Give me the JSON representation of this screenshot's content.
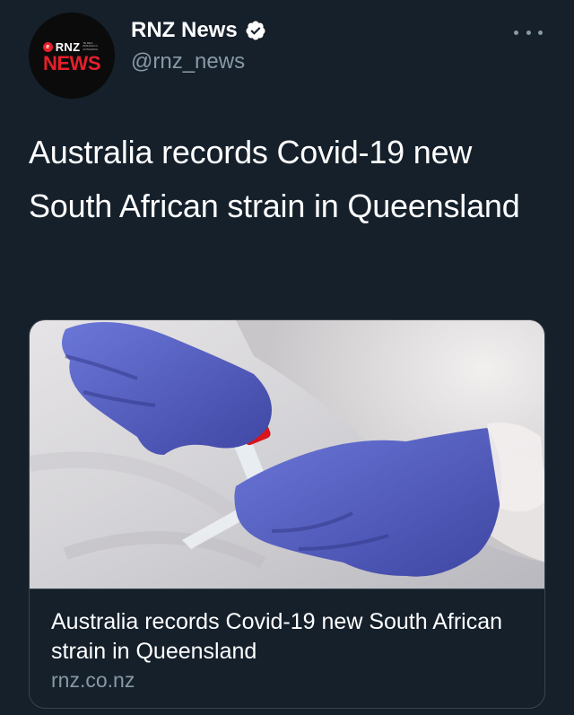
{
  "author": {
    "avatar": {
      "logo_top": "RNZ",
      "logo_small": "TE REO IRIRANGI O AOTEAROA",
      "logo_bottom": "NEWS"
    },
    "display_name": "RNZ News",
    "verified_icon": "verified-badge-icon",
    "handle": "@rnz_news",
    "more_icon": "more-options-icon"
  },
  "tweet": {
    "text": "Australia records Covid-19 new South African strain in Queensland"
  },
  "card": {
    "image_description_icon": "photo",
    "title": "Australia records Covid-19 new South African strain in Queensland",
    "domain": "rnz.co.nz"
  },
  "colors": {
    "background": "#15202b",
    "secondary_text": "#8899a6",
    "brand_red": "#e4202b",
    "border": "#38444d"
  }
}
